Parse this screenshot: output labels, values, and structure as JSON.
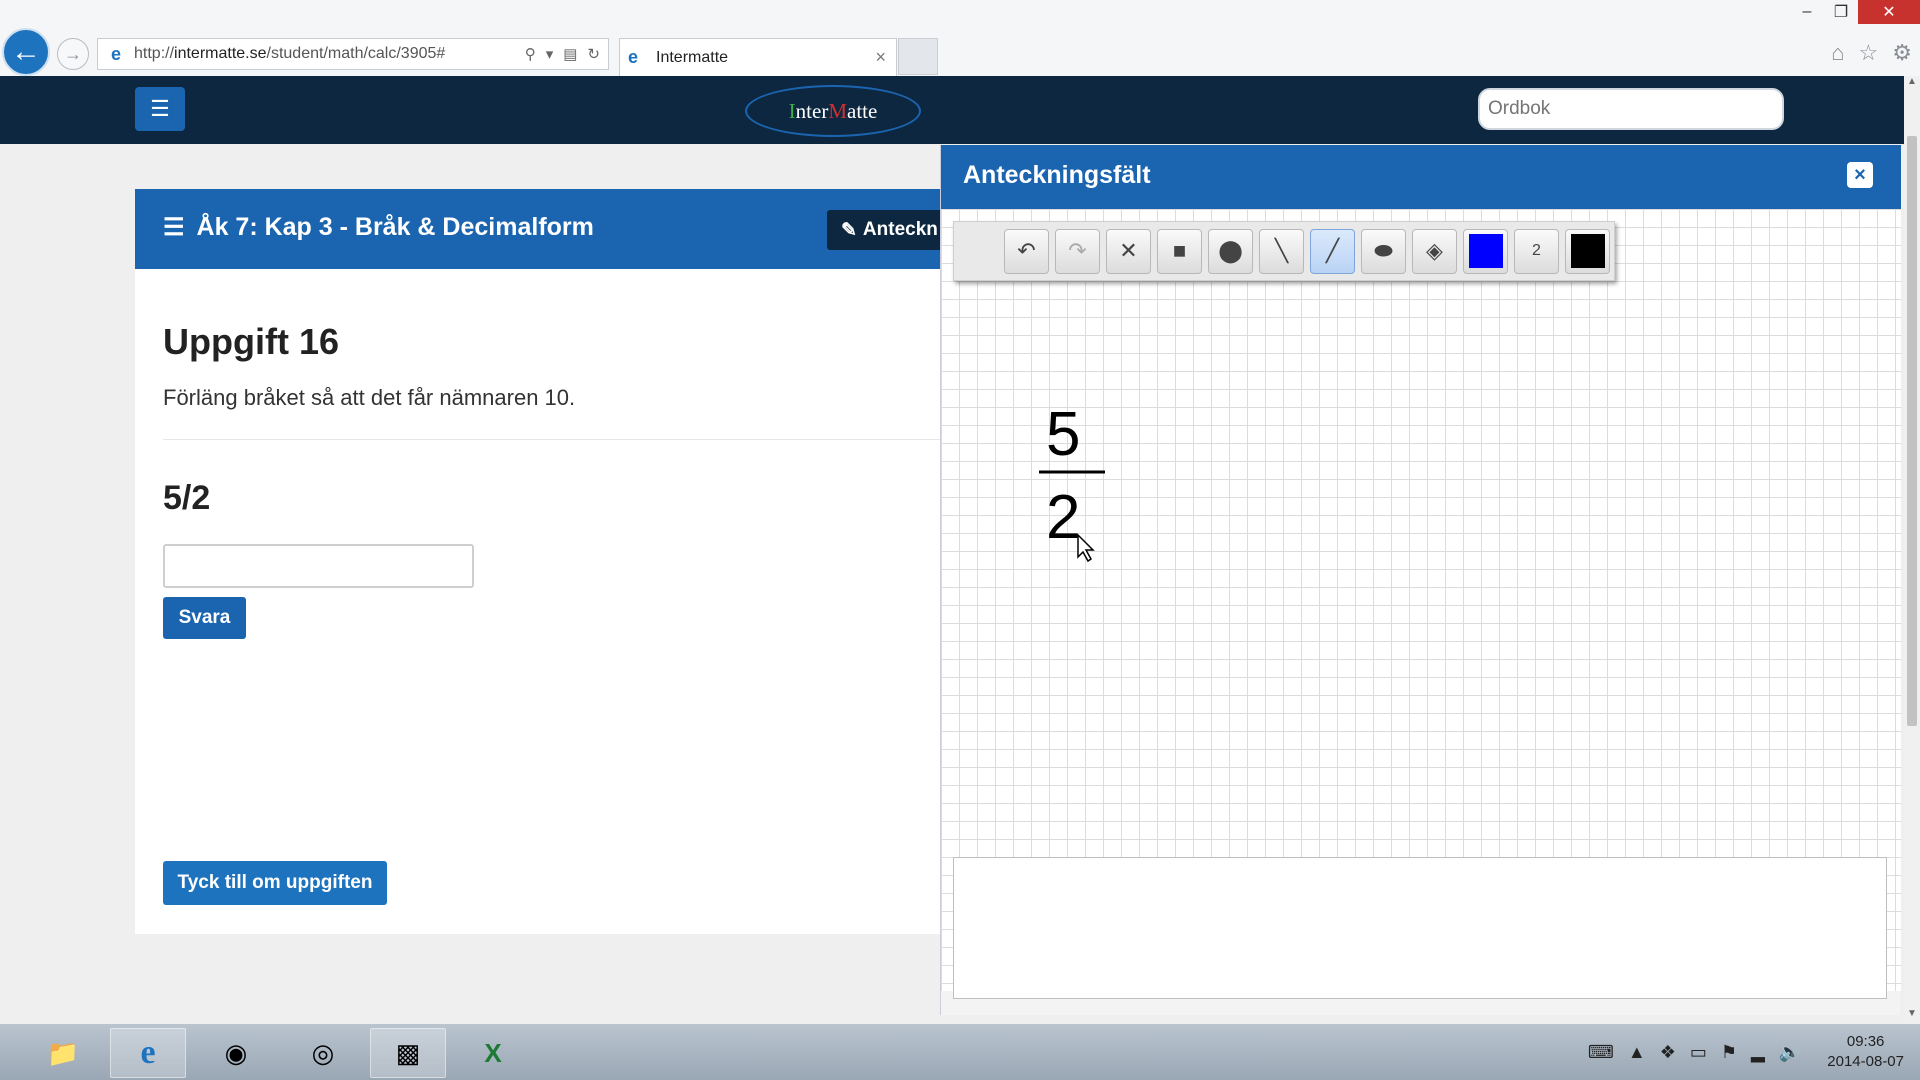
{
  "browser": {
    "url_prefix": "http://",
    "url_domain": "intermatte.se",
    "url_path": "/student/math/calc/3905#",
    "tab_title": "Intermatte"
  },
  "site": {
    "logo_i": "I",
    "logo_nter": "nter",
    "logo_m": "M",
    "logo_atte": "atte",
    "search_placeholder": "Ordbok"
  },
  "card": {
    "title": "Åk 7: Kap 3 - Bråk & Decimalform",
    "notes_button_label": "Anteckn",
    "task_title": "Uppgift 16",
    "task_description": "Förläng bråket så att det får nämnaren 10.",
    "fraction": "5/2",
    "answer_value": "",
    "submit_label": "Svara",
    "feedback_label": "Tyck till om uppgiften"
  },
  "notes": {
    "title": "Anteckningsfält",
    "close_label": "×",
    "pen_size": "2",
    "current_color": "#0000ff",
    "secondary_color": "#000000",
    "drawing": {
      "numerator": "5",
      "denominator": "2"
    }
  },
  "taskbar": {
    "time": "09:36",
    "date": "2014-08-07"
  }
}
